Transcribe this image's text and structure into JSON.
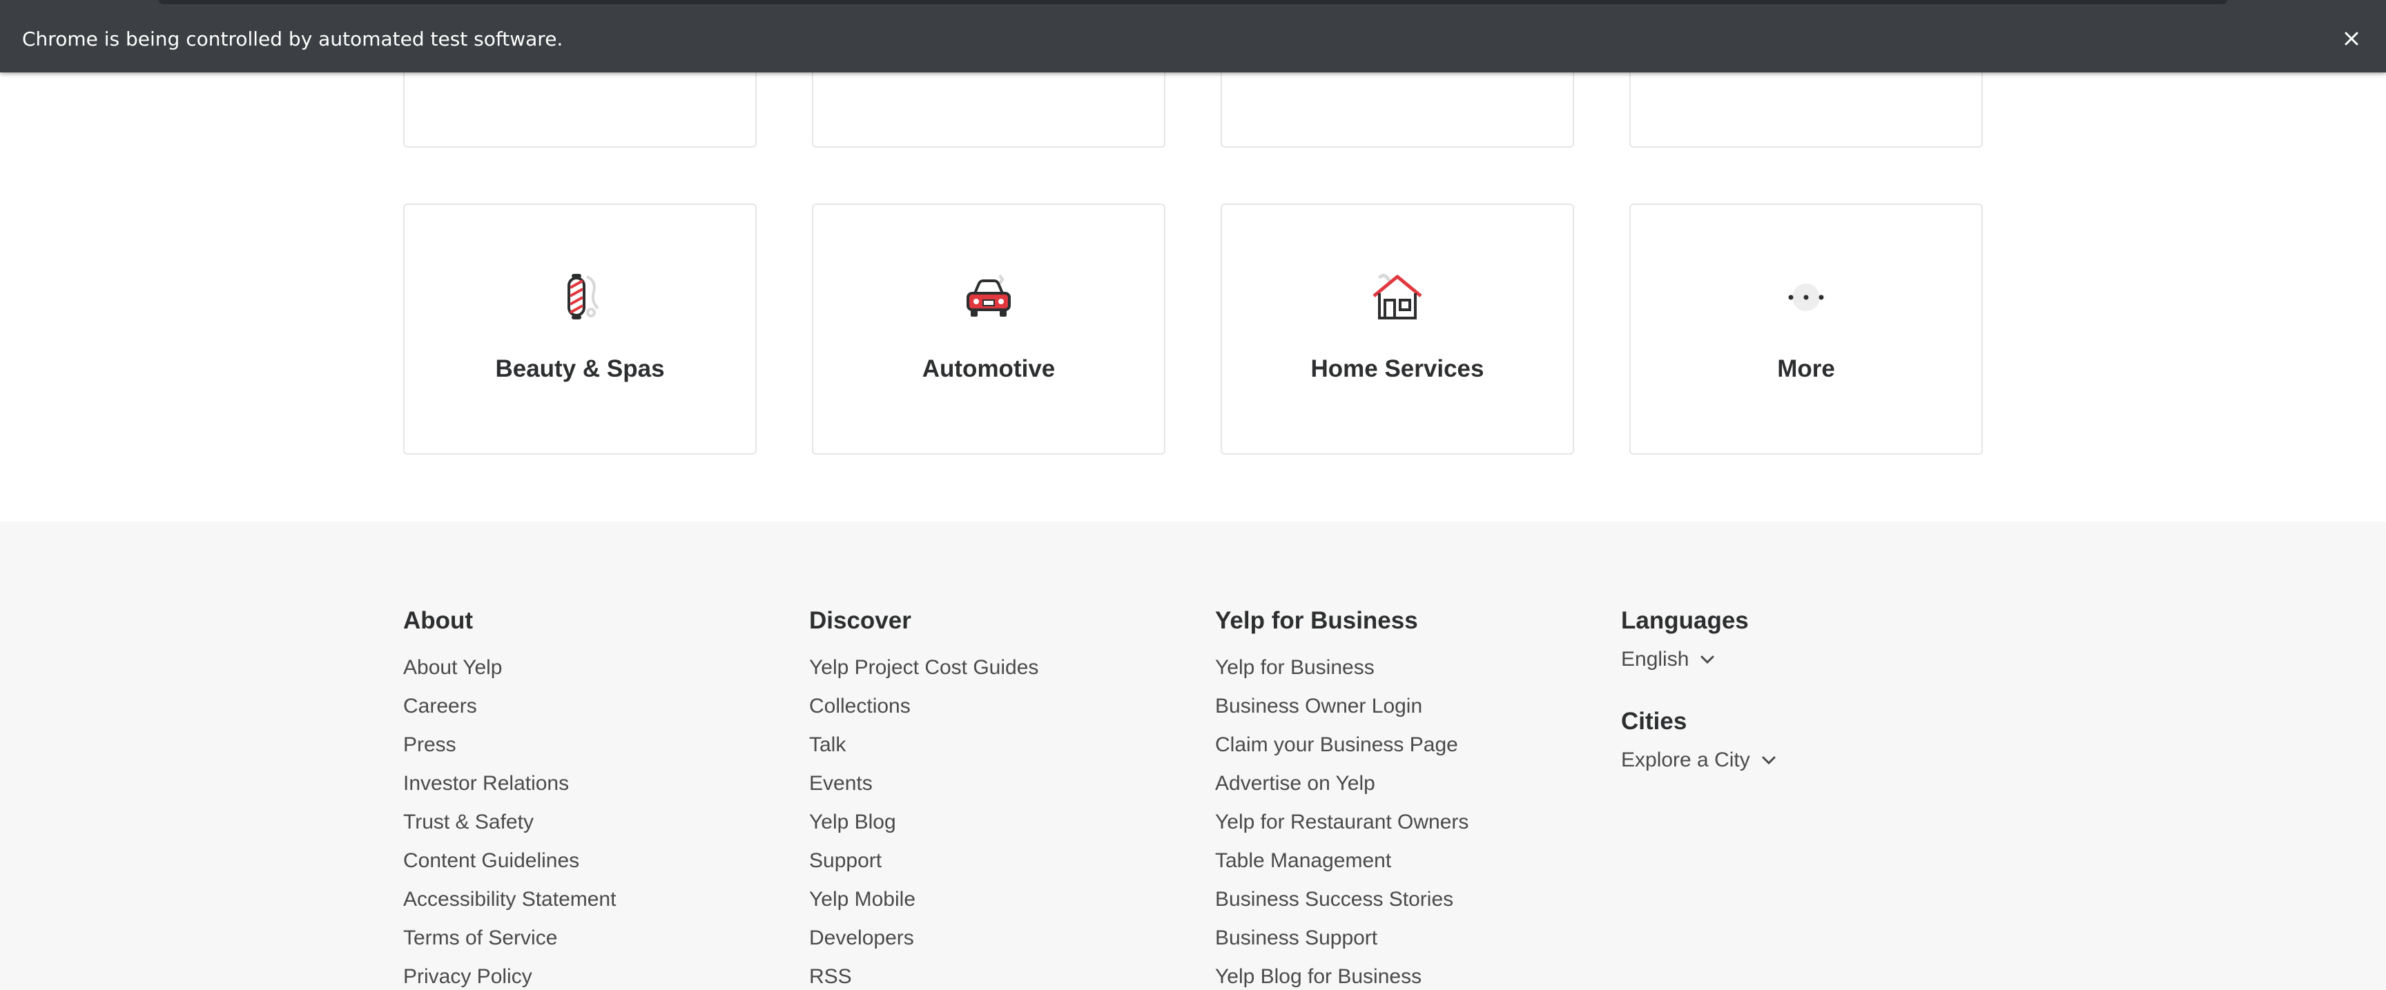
{
  "browser": {
    "automation_notice": "Chrome is being controlled by automated test software."
  },
  "categories": [
    {
      "label": "Beauty & Spas",
      "icon": "barber-pole-icon"
    },
    {
      "label": "Automotive",
      "icon": "car-icon"
    },
    {
      "label": "Home Services",
      "icon": "house-icon"
    },
    {
      "label": "More",
      "icon": "more-dots-icon"
    }
  ],
  "colors": {
    "brand_red": "#e0383e",
    "footer_bg": "#f7f7f7",
    "text_dark": "#2d2e2f"
  },
  "footer": {
    "about": {
      "heading": "About",
      "links": [
        "About Yelp",
        "Careers",
        "Press",
        "Investor Relations",
        "Trust & Safety",
        "Content Guidelines",
        "Accessibility Statement",
        "Terms of Service",
        "Privacy Policy"
      ]
    },
    "discover": {
      "heading": "Discover",
      "links": [
        "Yelp Project Cost Guides",
        "Collections",
        "Talk",
        "Events",
        "Yelp Blog",
        "Support",
        "Yelp Mobile",
        "Developers",
        "RSS"
      ]
    },
    "business": {
      "heading": "Yelp for Business",
      "links": [
        "Yelp for Business",
        "Business Owner Login",
        "Claim your Business Page",
        "Advertise on Yelp",
        "Yelp for Restaurant Owners",
        "Table Management",
        "Business Success Stories",
        "Business Support",
        "Yelp Blog for Business"
      ]
    },
    "languages": {
      "heading": "Languages",
      "selected": "English"
    },
    "cities": {
      "heading": "Cities",
      "selected": "Explore a City"
    }
  }
}
